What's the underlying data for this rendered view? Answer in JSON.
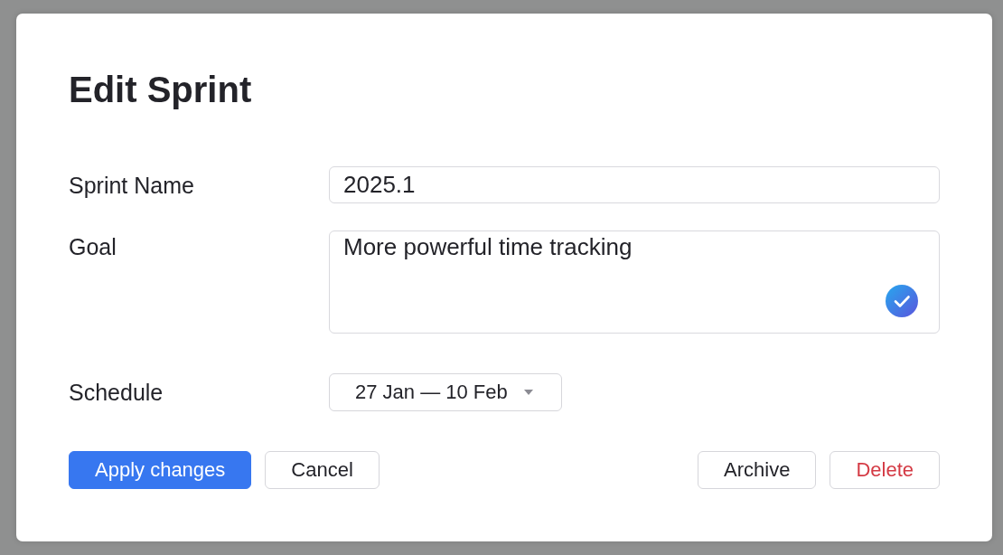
{
  "dialog": {
    "title": "Edit Sprint"
  },
  "fields": [
    {
      "kind": "text",
      "label": "Sprint Name",
      "value": "2025.1"
    },
    {
      "kind": "textarea",
      "label": "Goal",
      "value": "More powerful time tracking"
    },
    {
      "kind": "dropdown",
      "label": "Schedule",
      "value": "27 Jan — 10 Feb"
    }
  ],
  "actions": {
    "left": [
      {
        "kind": "primary",
        "label": "Apply changes"
      },
      {
        "kind": "secondary",
        "label": "Cancel"
      }
    ],
    "right": [
      {
        "kind": "secondary",
        "label": "Archive"
      },
      {
        "kind": "danger",
        "label": "Delete"
      }
    ]
  }
}
